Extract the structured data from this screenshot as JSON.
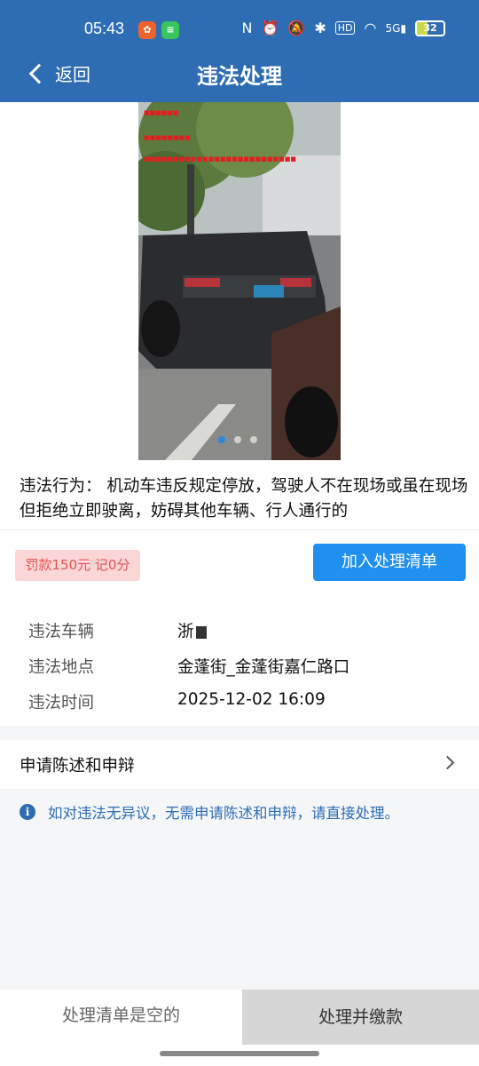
{
  "status_bar": {
    "time": "05:43",
    "battery": "32"
  },
  "nav": {
    "back_label": "返回",
    "title": "违法处理"
  },
  "violation": {
    "description": "违法行为： 机动车违反规定停放，驾驶人不在现场或虽在现场但拒绝立即驶离，妨碍其他车辆、行人通行的",
    "fine_tag": "罚款150元 记0分",
    "add_button_label": "加入处理清单"
  },
  "details": [
    {
      "label": "违法车辆",
      "value": "浙"
    },
    {
      "label": "违法地点",
      "value": "金蓬街_金蓬街嘉仁路口"
    },
    {
      "label": "违法时间",
      "value": "2025-12-02 16:09"
    }
  ],
  "appeal": {
    "label": "申请陈述和申辩"
  },
  "notice": {
    "text": "如对违法无异议，无需申请陈述和申辩，请直接处理。"
  },
  "bottom": {
    "cart_status": "处理清单是空的",
    "pay_label": "处理并缴款"
  },
  "colors": {
    "header": "#2e6db3",
    "primary_button": "#1f8ff0",
    "fine_tag_bg": "#fbd6d6",
    "fine_tag_text": "#e05555"
  }
}
